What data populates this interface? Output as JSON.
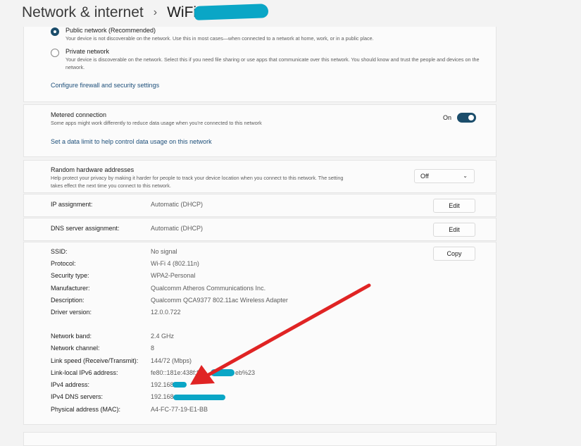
{
  "header": {
    "crumb": "Network & internet",
    "separator": "›",
    "current": "WiFi"
  },
  "network_profile": {
    "public": {
      "label": "Public network (Recommended)",
      "desc": "Your device is not discoverable on the network. Use this in most cases—when connected to a network at home, work, or in a public place.",
      "selected": true
    },
    "private": {
      "label": "Private network",
      "desc": "Your device is discoverable on the network. Select this if you need file sharing or use apps that communicate over this network. You should know and trust the people and devices on the network.",
      "selected": false
    },
    "firewall_link": "Configure firewall and security settings"
  },
  "metered": {
    "title": "Metered connection",
    "desc": "Some apps might work differently to reduce data usage when you're connected to this network",
    "toggle_label": "On",
    "data_limit_link": "Set a data limit to help control data usage on this network"
  },
  "random_hw": {
    "title": "Random hardware addresses",
    "desc1": "Help protect your privacy by making it harder for people to track your device location when you connect to this network. The setting",
    "desc2": "takes effect the next time you connect to this network.",
    "value": "Off"
  },
  "ip_assignment": {
    "label": "IP assignment:",
    "value": "Automatic (DHCP)",
    "button": "Edit"
  },
  "dns_assignment": {
    "label": "DNS server assignment:",
    "value": "Automatic (DHCP)",
    "button": "Edit"
  },
  "copy_button": "Copy",
  "props": [
    {
      "key": "SSID:",
      "value": "No signal"
    },
    {
      "key": "Protocol:",
      "value": "Wi-Fi 4 (802.11n)"
    },
    {
      "key": "Security type:",
      "value": "WPA2-Personal"
    },
    {
      "key": "Manufacturer:",
      "value": "Qualcomm Atheros Communications Inc."
    },
    {
      "key": "Description:",
      "value": "Qualcomm QCA9377 802.11ac Wireless Adapter"
    },
    {
      "key": "Driver version:",
      "value": "12.0.0.722"
    },
    {
      "key": "Network band:",
      "value": "2.4 GHz"
    },
    {
      "key": "Network channel:",
      "value": "8"
    },
    {
      "key": "Link speed (Receive/Transmit):",
      "value": "144/72 (Mbps)"
    },
    {
      "key": "Link-local IPv6 address:",
      "value": "fe80::181e:438f:8"
    },
    {
      "key": "IPv4 address:",
      "value": "192.168."
    },
    {
      "key": "IPv4 DNS servers:",
      "value": "192.168"
    },
    {
      "key": "Physical address (MAC):",
      "value": "A4-FC-77-19-E1-BB"
    }
  ],
  "ipv6_tail": "eb%23",
  "colors": {
    "accent": "#1b4d6b",
    "redaction": "#0aa6c6",
    "annotation_arrow": "#e02424"
  }
}
